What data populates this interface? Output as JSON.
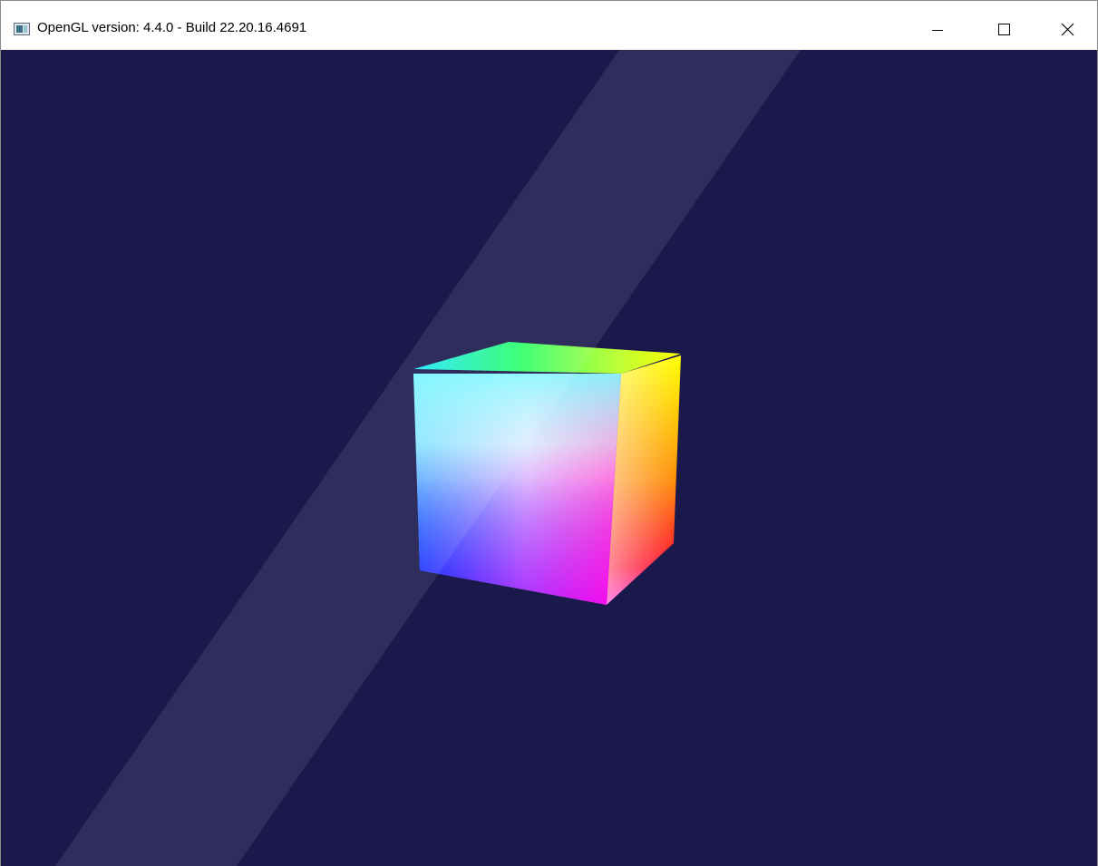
{
  "window": {
    "title": "OpenGL version: 4.4.0 - Build 22.20.16.4691",
    "icon": "application-icon",
    "controls": {
      "minimize_icon": "minimize-icon",
      "maximize_icon": "maximize-icon",
      "close_icon": "close-icon"
    }
  },
  "viewport": {
    "background_color": "#1b194b",
    "scene": "rgb-color-cube",
    "watermark_color": "#ffffff"
  }
}
